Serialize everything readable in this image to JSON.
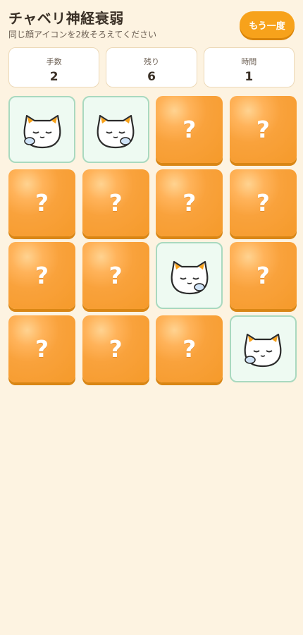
{
  "header": {
    "title": "チャベリ神経衰弱",
    "subtitle": "同じ顔アイコンを2枚そろえてください",
    "restart_label": "もう一度"
  },
  "stats": [
    {
      "label": "手数",
      "value": "2"
    },
    {
      "label": "残り",
      "value": "6"
    },
    {
      "label": "時間",
      "value": "1"
    }
  ],
  "board": {
    "hidden_symbol": "?",
    "cards": [
      {
        "state": "face-up",
        "icon": "cat-face-icon",
        "paw": "left"
      },
      {
        "state": "face-up",
        "icon": "cat-face-icon",
        "paw": "right"
      },
      {
        "state": "face-down"
      },
      {
        "state": "face-down"
      },
      {
        "state": "face-down"
      },
      {
        "state": "face-down"
      },
      {
        "state": "face-down"
      },
      {
        "state": "face-down"
      },
      {
        "state": "face-down"
      },
      {
        "state": "face-down"
      },
      {
        "state": "face-up",
        "icon": "cat-face-icon",
        "paw": "right"
      },
      {
        "state": "face-down"
      },
      {
        "state": "face-down"
      },
      {
        "state": "face-down"
      },
      {
        "state": "face-down"
      },
      {
        "state": "face-up",
        "icon": "cat-face-icon",
        "paw": "left"
      }
    ]
  },
  "colors": {
    "background": "#fdf3e1",
    "accent": "#f7a21b",
    "card_back": "#f9a23c",
    "card_face": "#eefaf2",
    "card_face_border": "#a9d9bf"
  }
}
